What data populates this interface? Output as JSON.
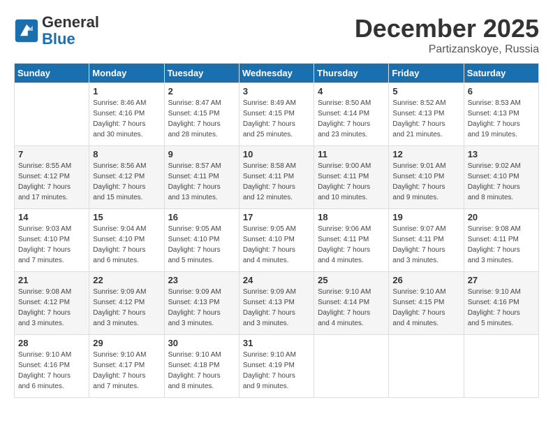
{
  "header": {
    "logo_line1": "General",
    "logo_line2": "Blue",
    "month": "December 2025",
    "location": "Partizanskoye, Russia"
  },
  "days_of_week": [
    "Sunday",
    "Monday",
    "Tuesday",
    "Wednesday",
    "Thursday",
    "Friday",
    "Saturday"
  ],
  "weeks": [
    [
      {
        "day": "",
        "info": ""
      },
      {
        "day": "1",
        "info": "Sunrise: 8:46 AM\nSunset: 4:16 PM\nDaylight: 7 hours\nand 30 minutes."
      },
      {
        "day": "2",
        "info": "Sunrise: 8:47 AM\nSunset: 4:15 PM\nDaylight: 7 hours\nand 28 minutes."
      },
      {
        "day": "3",
        "info": "Sunrise: 8:49 AM\nSunset: 4:15 PM\nDaylight: 7 hours\nand 25 minutes."
      },
      {
        "day": "4",
        "info": "Sunrise: 8:50 AM\nSunset: 4:14 PM\nDaylight: 7 hours\nand 23 minutes."
      },
      {
        "day": "5",
        "info": "Sunrise: 8:52 AM\nSunset: 4:13 PM\nDaylight: 7 hours\nand 21 minutes."
      },
      {
        "day": "6",
        "info": "Sunrise: 8:53 AM\nSunset: 4:13 PM\nDaylight: 7 hours\nand 19 minutes."
      }
    ],
    [
      {
        "day": "7",
        "info": "Sunrise: 8:55 AM\nSunset: 4:12 PM\nDaylight: 7 hours\nand 17 minutes."
      },
      {
        "day": "8",
        "info": "Sunrise: 8:56 AM\nSunset: 4:12 PM\nDaylight: 7 hours\nand 15 minutes."
      },
      {
        "day": "9",
        "info": "Sunrise: 8:57 AM\nSunset: 4:11 PM\nDaylight: 7 hours\nand 13 minutes."
      },
      {
        "day": "10",
        "info": "Sunrise: 8:58 AM\nSunset: 4:11 PM\nDaylight: 7 hours\nand 12 minutes."
      },
      {
        "day": "11",
        "info": "Sunrise: 9:00 AM\nSunset: 4:11 PM\nDaylight: 7 hours\nand 10 minutes."
      },
      {
        "day": "12",
        "info": "Sunrise: 9:01 AM\nSunset: 4:10 PM\nDaylight: 7 hours\nand 9 minutes."
      },
      {
        "day": "13",
        "info": "Sunrise: 9:02 AM\nSunset: 4:10 PM\nDaylight: 7 hours\nand 8 minutes."
      }
    ],
    [
      {
        "day": "14",
        "info": "Sunrise: 9:03 AM\nSunset: 4:10 PM\nDaylight: 7 hours\nand 7 minutes."
      },
      {
        "day": "15",
        "info": "Sunrise: 9:04 AM\nSunset: 4:10 PM\nDaylight: 7 hours\nand 6 minutes."
      },
      {
        "day": "16",
        "info": "Sunrise: 9:05 AM\nSunset: 4:10 PM\nDaylight: 7 hours\nand 5 minutes."
      },
      {
        "day": "17",
        "info": "Sunrise: 9:05 AM\nSunset: 4:10 PM\nDaylight: 7 hours\nand 4 minutes."
      },
      {
        "day": "18",
        "info": "Sunrise: 9:06 AM\nSunset: 4:11 PM\nDaylight: 7 hours\nand 4 minutes."
      },
      {
        "day": "19",
        "info": "Sunrise: 9:07 AM\nSunset: 4:11 PM\nDaylight: 7 hours\nand 3 minutes."
      },
      {
        "day": "20",
        "info": "Sunrise: 9:08 AM\nSunset: 4:11 PM\nDaylight: 7 hours\nand 3 minutes."
      }
    ],
    [
      {
        "day": "21",
        "info": "Sunrise: 9:08 AM\nSunset: 4:12 PM\nDaylight: 7 hours\nand 3 minutes."
      },
      {
        "day": "22",
        "info": "Sunrise: 9:09 AM\nSunset: 4:12 PM\nDaylight: 7 hours\nand 3 minutes."
      },
      {
        "day": "23",
        "info": "Sunrise: 9:09 AM\nSunset: 4:13 PM\nDaylight: 7 hours\nand 3 minutes."
      },
      {
        "day": "24",
        "info": "Sunrise: 9:09 AM\nSunset: 4:13 PM\nDaylight: 7 hours\nand 3 minutes."
      },
      {
        "day": "25",
        "info": "Sunrise: 9:10 AM\nSunset: 4:14 PM\nDaylight: 7 hours\nand 4 minutes."
      },
      {
        "day": "26",
        "info": "Sunrise: 9:10 AM\nSunset: 4:15 PM\nDaylight: 7 hours\nand 4 minutes."
      },
      {
        "day": "27",
        "info": "Sunrise: 9:10 AM\nSunset: 4:16 PM\nDaylight: 7 hours\nand 5 minutes."
      }
    ],
    [
      {
        "day": "28",
        "info": "Sunrise: 9:10 AM\nSunset: 4:16 PM\nDaylight: 7 hours\nand 6 minutes."
      },
      {
        "day": "29",
        "info": "Sunrise: 9:10 AM\nSunset: 4:17 PM\nDaylight: 7 hours\nand 7 minutes."
      },
      {
        "day": "30",
        "info": "Sunrise: 9:10 AM\nSunset: 4:18 PM\nDaylight: 7 hours\nand 8 minutes."
      },
      {
        "day": "31",
        "info": "Sunrise: 9:10 AM\nSunset: 4:19 PM\nDaylight: 7 hours\nand 9 minutes."
      },
      {
        "day": "",
        "info": ""
      },
      {
        "day": "",
        "info": ""
      },
      {
        "day": "",
        "info": ""
      }
    ]
  ]
}
